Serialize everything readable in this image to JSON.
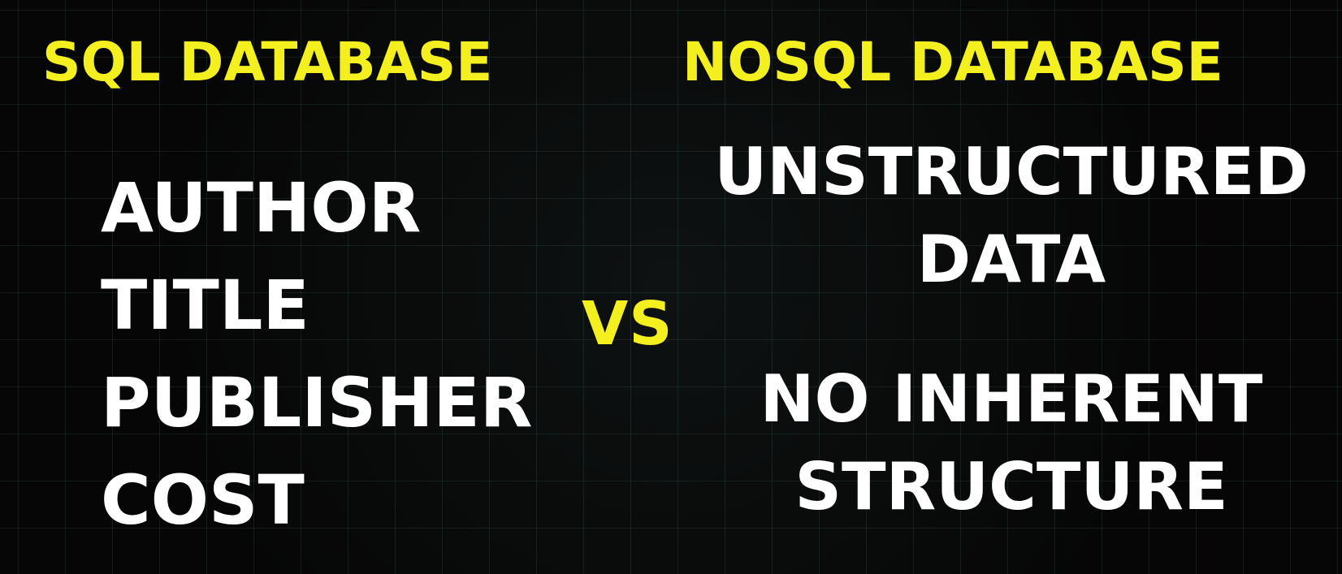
{
  "left": {
    "heading": "SQL DATABASE",
    "items": [
      "AUTHOR",
      "TITLE",
      "PUBLISHER",
      "COST"
    ]
  },
  "center": {
    "label": "VS"
  },
  "right": {
    "heading": "NOSQL DATABASE",
    "points": [
      {
        "line1": "UNSTRUCTURED",
        "line2": "DATA"
      },
      {
        "line1": "NO INHERENT",
        "line2": "STRUCTURE"
      }
    ]
  },
  "colors": {
    "accent": "#f4ef1f",
    "text": "#ffffff",
    "background": "#060606",
    "grid": "#6eaaaa"
  }
}
